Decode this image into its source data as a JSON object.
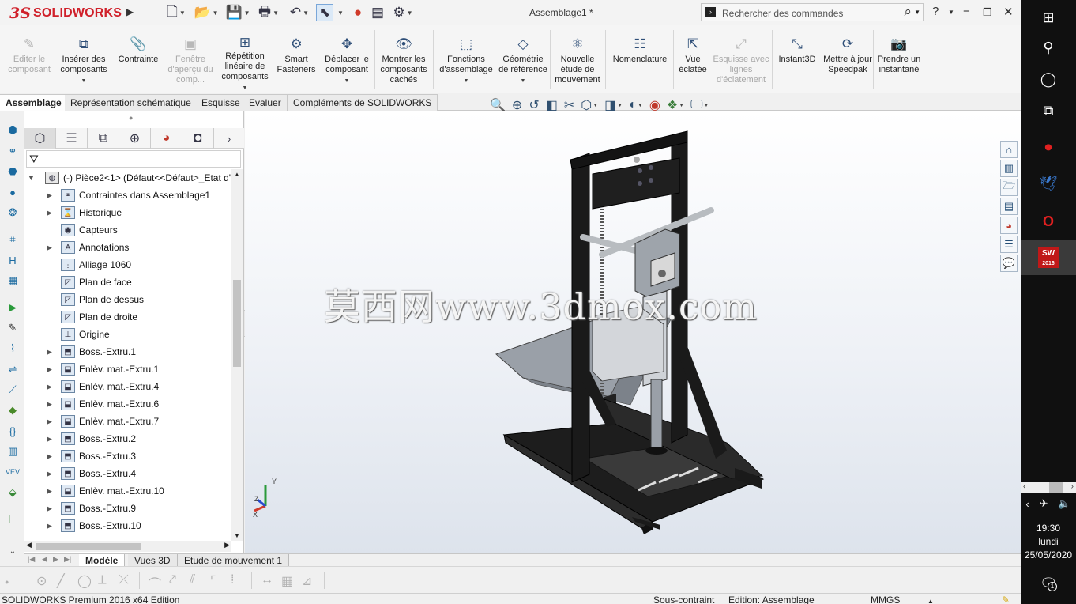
{
  "app": {
    "brand": "SOLIDWORKS",
    "brand_prefix": "3S",
    "doc_title": "Assemblage1 *"
  },
  "search": {
    "placeholder": "Rechercher des commandes"
  },
  "ribbon": [
    {
      "label": "Editer le composant",
      "icon": "edit-component-icon",
      "enabled": false
    },
    {
      "label": "Insérer des composants",
      "icon": "insert-components-icon",
      "enabled": true
    },
    {
      "label": "Contrainte",
      "icon": "mate-paperclip-icon",
      "enabled": true
    },
    {
      "label": "Fenêtre d'aperçu du comp...",
      "icon": "preview-window-icon",
      "enabled": false
    },
    {
      "label": "Répétition linéaire de composants",
      "icon": "linear-pattern-icon",
      "enabled": true
    },
    {
      "label": "Smart Fasteners",
      "icon": "smart-fasteners-icon",
      "enabled": true
    },
    {
      "label": "Déplacer le composant",
      "icon": "move-component-icon",
      "enabled": true
    },
    {
      "label": "Montrer les composants cachés",
      "icon": "show-hidden-icon",
      "enabled": true
    },
    {
      "label": "Fonctions d'assemblage",
      "icon": "assembly-features-icon",
      "enabled": true
    },
    {
      "label": "Géométrie de référence",
      "icon": "reference-geometry-icon",
      "enabled": true
    },
    {
      "label": "Nouvelle étude de mouvement",
      "icon": "motion-study-icon",
      "enabled": true
    },
    {
      "label": "Nomenclature",
      "icon": "bom-icon",
      "enabled": true
    },
    {
      "label": "Vue éclatée",
      "icon": "exploded-view-icon",
      "enabled": true
    },
    {
      "label": "Esquisse avec lignes d'éclatement",
      "icon": "explode-line-sketch-icon",
      "enabled": false
    },
    {
      "label": "Instant3D",
      "icon": "instant3d-icon",
      "enabled": true
    },
    {
      "label": "Mettre à jour Speedpak",
      "icon": "speedpak-icon",
      "enabled": true
    },
    {
      "label": "Prendre un instantané",
      "icon": "snapshot-camera-icon",
      "enabled": true
    }
  ],
  "cm_tabs": [
    "Assemblage",
    "Représentation schématique",
    "Esquisse",
    "Evaluer",
    "Compléments de SOLIDWORKS"
  ],
  "tree": {
    "root": "(-) Pièce2<1> (Défaut<<Défaut>_Etat d'...",
    "items": [
      {
        "label": "Contraintes dans Assemblage1",
        "expandable": true,
        "icon": "mates-folder-icon"
      },
      {
        "label": "Historique",
        "expandable": true,
        "icon": "history-icon"
      },
      {
        "label": "Capteurs",
        "expandable": false,
        "icon": "sensors-icon"
      },
      {
        "label": "Annotations",
        "expandable": true,
        "icon": "annotations-icon"
      },
      {
        "label": "Alliage 1060",
        "expandable": false,
        "icon": "material-icon"
      },
      {
        "label": "Plan de face",
        "expandable": false,
        "icon": "plane-icon"
      },
      {
        "label": "Plan de dessus",
        "expandable": false,
        "icon": "plane-icon"
      },
      {
        "label": "Plan de droite",
        "expandable": false,
        "icon": "plane-icon"
      },
      {
        "label": "Origine",
        "expandable": false,
        "icon": "origin-icon"
      },
      {
        "label": "Boss.-Extru.1",
        "expandable": true,
        "icon": "boss-extrude-icon"
      },
      {
        "label": "Enlèv. mat.-Extru.1",
        "expandable": true,
        "icon": "cut-extrude-icon"
      },
      {
        "label": "Enlèv. mat.-Extru.4",
        "expandable": true,
        "icon": "cut-extrude-icon"
      },
      {
        "label": "Enlèv. mat.-Extru.6",
        "expandable": true,
        "icon": "cut-extrude-icon"
      },
      {
        "label": "Enlèv. mat.-Extru.7",
        "expandable": true,
        "icon": "cut-extrude-icon"
      },
      {
        "label": "Boss.-Extru.2",
        "expandable": true,
        "icon": "boss-extrude-icon"
      },
      {
        "label": "Boss.-Extru.3",
        "expandable": true,
        "icon": "boss-extrude-icon"
      },
      {
        "label": "Boss.-Extru.4",
        "expandable": true,
        "icon": "boss-extrude-icon"
      },
      {
        "label": "Enlèv. mat.-Extru.10",
        "expandable": true,
        "icon": "cut-extrude-icon"
      },
      {
        "label": "Boss.-Extru.9",
        "expandable": true,
        "icon": "boss-extrude-icon"
      },
      {
        "label": "Boss.-Extru.10",
        "expandable": true,
        "icon": "boss-extrude-icon"
      }
    ]
  },
  "viewport": {
    "watermark": "莫西网www.3dmox.com",
    "triad": {
      "x": "X",
      "y": "Y",
      "z": "Z"
    }
  },
  "bottom_tabs": [
    "Modèle",
    "Vues 3D",
    "Etude de mouvement 1"
  ],
  "status": {
    "product": "SOLIDWORKS Premium 2016 x64 Edition",
    "constraint": "Sous-contraint",
    "mode": "Edition: Assemblage",
    "units": "MMGS"
  },
  "taskbar": {
    "time": "19:30",
    "day": "lundi",
    "date": "25/05/2020",
    "notification_count": "1",
    "sw_badge": "SW",
    "sw_year": "2016"
  }
}
